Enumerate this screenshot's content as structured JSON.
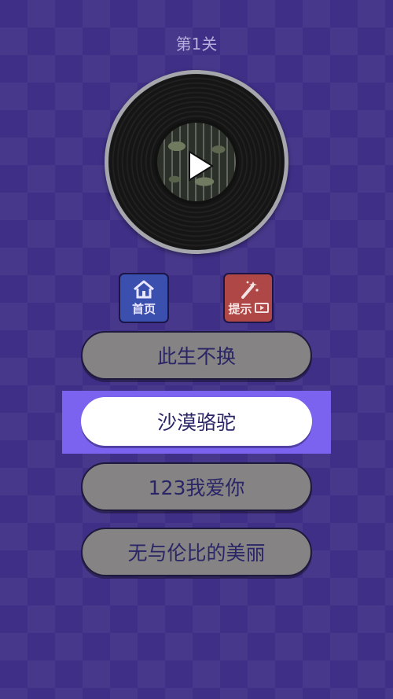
{
  "level": {
    "title": "第1关"
  },
  "record": {
    "play_icon": "play-icon"
  },
  "buttons": {
    "home_label": "首页",
    "home_icon": "home-icon",
    "hint_label": "提示",
    "hint_icon": "magic-wand-icon",
    "hint_ad_icon": "video-icon"
  },
  "options": [
    {
      "label": "此生不换",
      "selected": false
    },
    {
      "label": "沙漠骆驼",
      "selected": true
    },
    {
      "label": "123我爱你",
      "selected": false
    },
    {
      "label": "无与伦比的美丽",
      "selected": false
    }
  ],
  "colors": {
    "background": "#3f2f86",
    "highlight": "#7b63f0",
    "option_default": "#858383",
    "option_selected": "#ffffff",
    "home_button": "#3b4fae",
    "hint_button": "#b04747"
  }
}
